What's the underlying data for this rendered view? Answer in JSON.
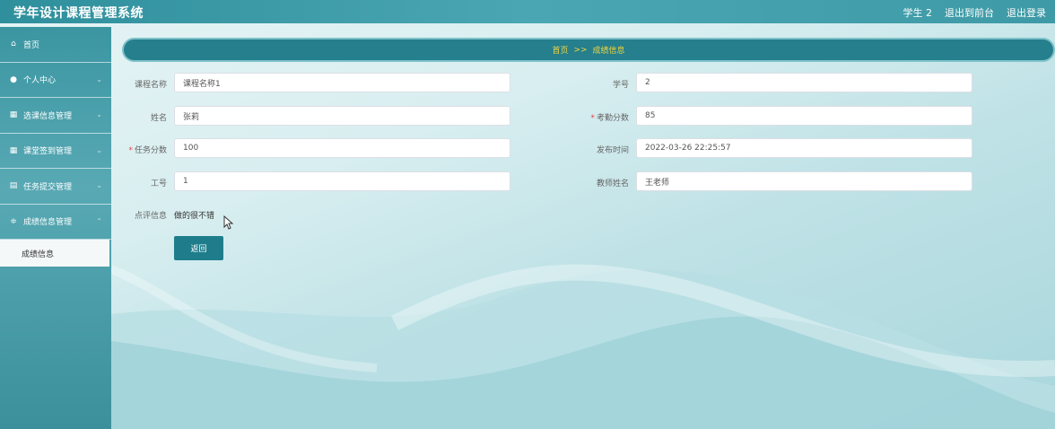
{
  "header": {
    "app_title": "学年设计课程管理系统",
    "user_label": "学生 2",
    "back_to_front": "退出到前台",
    "logout": "退出登录"
  },
  "sidebar": {
    "items": [
      {
        "label": "首页",
        "icon": "home-icon"
      },
      {
        "label": "个人中心",
        "icon": "user-icon"
      },
      {
        "label": "选课信息管理",
        "icon": "grid-icon"
      },
      {
        "label": "课堂签到管理",
        "icon": "grid-icon"
      },
      {
        "label": "任务提交管理",
        "icon": "clipboard-icon"
      },
      {
        "label": "成绩信息管理",
        "icon": "sliders-icon"
      }
    ],
    "submenu_active": "成绩信息"
  },
  "breadcrumb": {
    "home": "首页",
    "separator": ">>",
    "current": "成绩信息"
  },
  "form": {
    "course_name_label": "课程名称",
    "course_name_value": "课程名称1",
    "student_id_label": "学号",
    "student_id_value": "2",
    "name_label": "姓名",
    "name_value": "张莉",
    "attendance_label": "考勤分数",
    "attendance_value": "85",
    "task_score_label": "任务分数",
    "task_score_value": "100",
    "publish_time_label": "发布时间",
    "publish_time_value": "2022-03-26 22:25:57",
    "staff_id_label": "工号",
    "staff_id_value": "1",
    "teacher_name_label": "教师姓名",
    "teacher_name_value": "王老师",
    "comment_label": "点评信息",
    "comment_value": "做的很不错",
    "required_mark": "*"
  },
  "buttons": {
    "back": "返回"
  },
  "colors": {
    "accent": "#1f7d8b",
    "breadcrumb_text": "#f2d53c",
    "required": "#e04a4a"
  }
}
